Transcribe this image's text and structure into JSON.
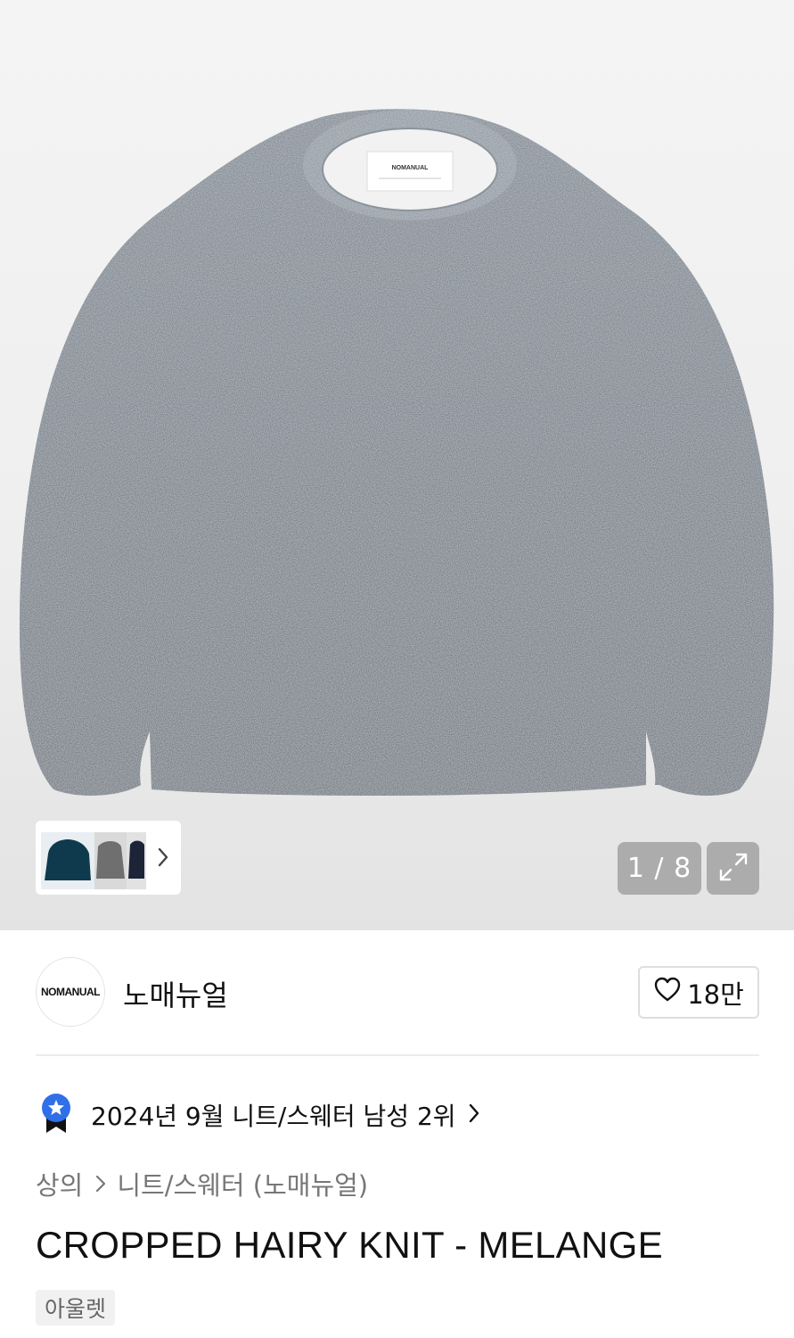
{
  "gallery": {
    "pager": "1 / 8",
    "background_color": "#efefef"
  },
  "thumbnails": {
    "colors": [
      "#0f3a4e",
      "#6f6f6f",
      "#1d2438"
    ]
  },
  "brand": {
    "logo_text": "NOMANUAL",
    "name": "노매뉴얼",
    "like_count": "18만"
  },
  "ranking": {
    "text": "2024년 9월 니트/스웨터 남성 2위"
  },
  "breadcrumb": {
    "level1": "상의",
    "level2": "니트/스웨터 (노매뉴얼)"
  },
  "product": {
    "title": "CROPPED HAIRY KNIT - MELANGE",
    "tag": "아울렛"
  },
  "colors": {
    "sweater": "#5a6470",
    "badge_blue": "#2f6fe8"
  }
}
